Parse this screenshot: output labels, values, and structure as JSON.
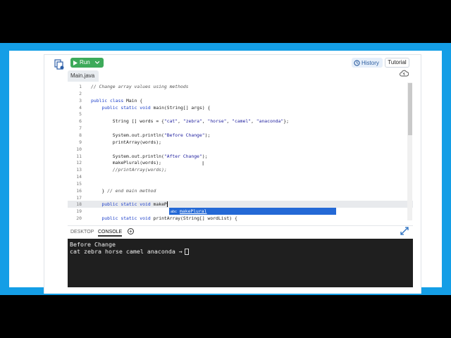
{
  "toolbar": {
    "run_label": "Run",
    "history_label": "History",
    "tutorial_label": "Tutorial"
  },
  "file_tab": {
    "name": "Main.java"
  },
  "editor": {
    "lines": [
      {
        "n": "1",
        "text": "// Change array values using methods"
      },
      {
        "n": "2",
        "text": ""
      },
      {
        "n": "3",
        "text": "public class Main {"
      },
      {
        "n": "4",
        "text": "    public static void main(String[] args) {"
      },
      {
        "n": "5",
        "text": ""
      },
      {
        "n": "6",
        "text": "        String [] words = {\"cat\", \"zebra\", \"horse\", \"camel\", \"anaconda\"};"
      },
      {
        "n": "7",
        "text": ""
      },
      {
        "n": "8",
        "text": "        System.out.println(\"Before Change\");"
      },
      {
        "n": "9",
        "text": "        printArray(words);"
      },
      {
        "n": "10",
        "text": ""
      },
      {
        "n": "11",
        "text": "        System.out.println(\"After Change\");"
      },
      {
        "n": "12",
        "text": "        makePlural(words);"
      },
      {
        "n": "13",
        "text": "        //printArray(words);"
      },
      {
        "n": "14",
        "text": ""
      },
      {
        "n": "15",
        "text": ""
      },
      {
        "n": "16",
        "text": "    } // end main method"
      },
      {
        "n": "17",
        "text": ""
      },
      {
        "n": "18",
        "text": "    public static void makeP"
      },
      {
        "n": "19",
        "text": ""
      },
      {
        "n": "20",
        "text": "    public static void printArray(String[] wordList) {"
      }
    ],
    "active_line": "18"
  },
  "autocomplete": {
    "badge": "abc",
    "suggestion": "makePlural"
  },
  "console": {
    "tabs": {
      "desktop": "DESKTOP",
      "console": "CONSOLE",
      "add": "+"
    },
    "output": [
      "Before Change",
      "cat zebra horse camel anaconda →"
    ]
  },
  "colors": {
    "frame": "#149ee6",
    "run": "#3daa5a",
    "autocomplete": "#2469d6",
    "terminal": "#1f1f1f"
  },
  "icons": [
    "files-icon",
    "play-icon",
    "chevron-down-icon",
    "history-icon",
    "cloud-icon",
    "expand-icon"
  ]
}
